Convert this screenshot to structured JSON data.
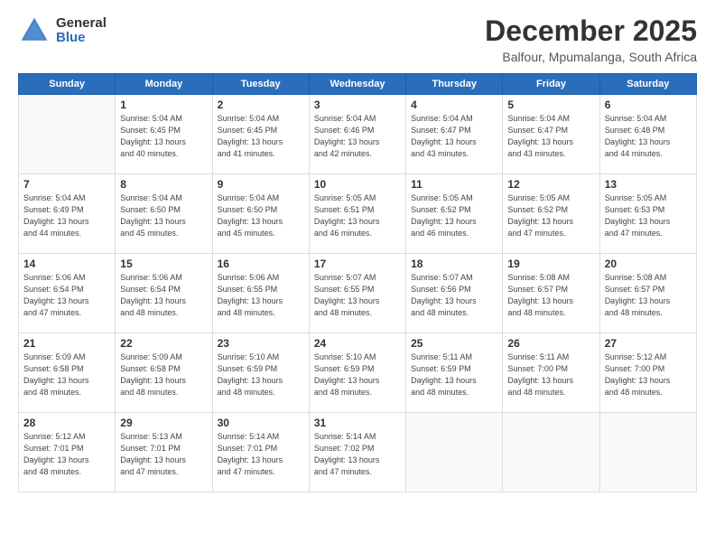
{
  "logo": {
    "general": "General",
    "blue": "Blue"
  },
  "header": {
    "title": "December 2025",
    "location": "Balfour, Mpumalanga, South Africa"
  },
  "weekdays": [
    "Sunday",
    "Monday",
    "Tuesday",
    "Wednesday",
    "Thursday",
    "Friday",
    "Saturday"
  ],
  "weeks": [
    [
      {
        "day": "",
        "info": ""
      },
      {
        "day": "1",
        "info": "Sunrise: 5:04 AM\nSunset: 6:45 PM\nDaylight: 13 hours\nand 40 minutes."
      },
      {
        "day": "2",
        "info": "Sunrise: 5:04 AM\nSunset: 6:45 PM\nDaylight: 13 hours\nand 41 minutes."
      },
      {
        "day": "3",
        "info": "Sunrise: 5:04 AM\nSunset: 6:46 PM\nDaylight: 13 hours\nand 42 minutes."
      },
      {
        "day": "4",
        "info": "Sunrise: 5:04 AM\nSunset: 6:47 PM\nDaylight: 13 hours\nand 43 minutes."
      },
      {
        "day": "5",
        "info": "Sunrise: 5:04 AM\nSunset: 6:47 PM\nDaylight: 13 hours\nand 43 minutes."
      },
      {
        "day": "6",
        "info": "Sunrise: 5:04 AM\nSunset: 6:48 PM\nDaylight: 13 hours\nand 44 minutes."
      }
    ],
    [
      {
        "day": "7",
        "info": "Sunrise: 5:04 AM\nSunset: 6:49 PM\nDaylight: 13 hours\nand 44 minutes."
      },
      {
        "day": "8",
        "info": "Sunrise: 5:04 AM\nSunset: 6:50 PM\nDaylight: 13 hours\nand 45 minutes."
      },
      {
        "day": "9",
        "info": "Sunrise: 5:04 AM\nSunset: 6:50 PM\nDaylight: 13 hours\nand 45 minutes."
      },
      {
        "day": "10",
        "info": "Sunrise: 5:05 AM\nSunset: 6:51 PM\nDaylight: 13 hours\nand 46 minutes."
      },
      {
        "day": "11",
        "info": "Sunrise: 5:05 AM\nSunset: 6:52 PM\nDaylight: 13 hours\nand 46 minutes."
      },
      {
        "day": "12",
        "info": "Sunrise: 5:05 AM\nSunset: 6:52 PM\nDaylight: 13 hours\nand 47 minutes."
      },
      {
        "day": "13",
        "info": "Sunrise: 5:05 AM\nSunset: 6:53 PM\nDaylight: 13 hours\nand 47 minutes."
      }
    ],
    [
      {
        "day": "14",
        "info": "Sunrise: 5:06 AM\nSunset: 6:54 PM\nDaylight: 13 hours\nand 47 minutes."
      },
      {
        "day": "15",
        "info": "Sunrise: 5:06 AM\nSunset: 6:54 PM\nDaylight: 13 hours\nand 48 minutes."
      },
      {
        "day": "16",
        "info": "Sunrise: 5:06 AM\nSunset: 6:55 PM\nDaylight: 13 hours\nand 48 minutes."
      },
      {
        "day": "17",
        "info": "Sunrise: 5:07 AM\nSunset: 6:55 PM\nDaylight: 13 hours\nand 48 minutes."
      },
      {
        "day": "18",
        "info": "Sunrise: 5:07 AM\nSunset: 6:56 PM\nDaylight: 13 hours\nand 48 minutes."
      },
      {
        "day": "19",
        "info": "Sunrise: 5:08 AM\nSunset: 6:57 PM\nDaylight: 13 hours\nand 48 minutes."
      },
      {
        "day": "20",
        "info": "Sunrise: 5:08 AM\nSunset: 6:57 PM\nDaylight: 13 hours\nand 48 minutes."
      }
    ],
    [
      {
        "day": "21",
        "info": "Sunrise: 5:09 AM\nSunset: 6:58 PM\nDaylight: 13 hours\nand 48 minutes."
      },
      {
        "day": "22",
        "info": "Sunrise: 5:09 AM\nSunset: 6:58 PM\nDaylight: 13 hours\nand 48 minutes."
      },
      {
        "day": "23",
        "info": "Sunrise: 5:10 AM\nSunset: 6:59 PM\nDaylight: 13 hours\nand 48 minutes."
      },
      {
        "day": "24",
        "info": "Sunrise: 5:10 AM\nSunset: 6:59 PM\nDaylight: 13 hours\nand 48 minutes."
      },
      {
        "day": "25",
        "info": "Sunrise: 5:11 AM\nSunset: 6:59 PM\nDaylight: 13 hours\nand 48 minutes."
      },
      {
        "day": "26",
        "info": "Sunrise: 5:11 AM\nSunset: 7:00 PM\nDaylight: 13 hours\nand 48 minutes."
      },
      {
        "day": "27",
        "info": "Sunrise: 5:12 AM\nSunset: 7:00 PM\nDaylight: 13 hours\nand 48 minutes."
      }
    ],
    [
      {
        "day": "28",
        "info": "Sunrise: 5:12 AM\nSunset: 7:01 PM\nDaylight: 13 hours\nand 48 minutes."
      },
      {
        "day": "29",
        "info": "Sunrise: 5:13 AM\nSunset: 7:01 PM\nDaylight: 13 hours\nand 47 minutes."
      },
      {
        "day": "30",
        "info": "Sunrise: 5:14 AM\nSunset: 7:01 PM\nDaylight: 13 hours\nand 47 minutes."
      },
      {
        "day": "31",
        "info": "Sunrise: 5:14 AM\nSunset: 7:02 PM\nDaylight: 13 hours\nand 47 minutes."
      },
      {
        "day": "",
        "info": ""
      },
      {
        "day": "",
        "info": ""
      },
      {
        "day": "",
        "info": ""
      }
    ]
  ]
}
